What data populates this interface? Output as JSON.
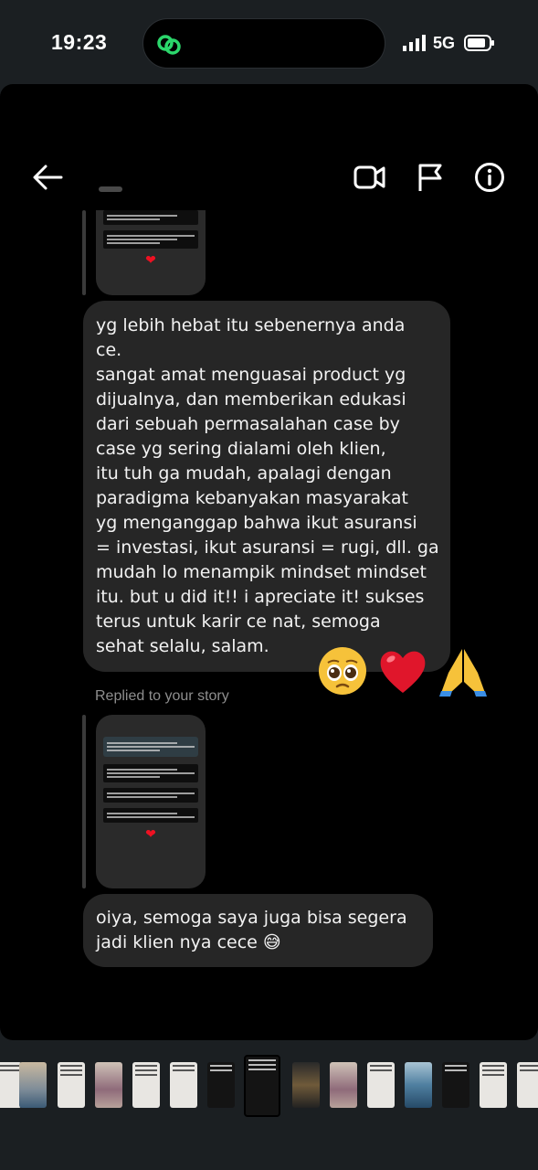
{
  "status_bar": {
    "time": "19:23",
    "network": "5G"
  },
  "header": {
    "icons": [
      "back-arrow-icon",
      "video-call-icon",
      "flag-icon",
      "info-icon"
    ]
  },
  "messages": [
    {
      "type": "text",
      "lines": [
        "yg lebih hebat itu sebenernya anda",
        "ce.",
        "sangat amat menguasai product yg",
        "dijualnya, dan memberikan edukasi",
        "dari sebuah permasalahan case by",
        "case yg sering dialami oleh klien,",
        "itu tuh ga mudah, apalagi dengan",
        "paradigma kebanyakan masyarakat",
        "yg menganggap bahwa ikut asuransi",
        "= investasi, ikut asuransi = rugi, dll. ga",
        "mudah lo menampik mindset mindset",
        "itu. but u did it!! i apreciate it! sukses",
        "terus untuk karir ce nat, semoga",
        "sehat selalu, salam."
      ],
      "reactions": [
        "🥺",
        "❤️",
        "🙏"
      ]
    },
    {
      "type": "story_reply",
      "label": "Replied to your story"
    },
    {
      "type": "text",
      "lines": [
        "oiya, semoga saya juga bisa segera",
        "jadi klien nya cece 😅"
      ]
    }
  ],
  "colors": {
    "background": "#000000",
    "bubble": "#262626",
    "status_bg": "#1b1f22",
    "muted_text": "#8e8e8e",
    "accent_green": "#2bd66b"
  }
}
